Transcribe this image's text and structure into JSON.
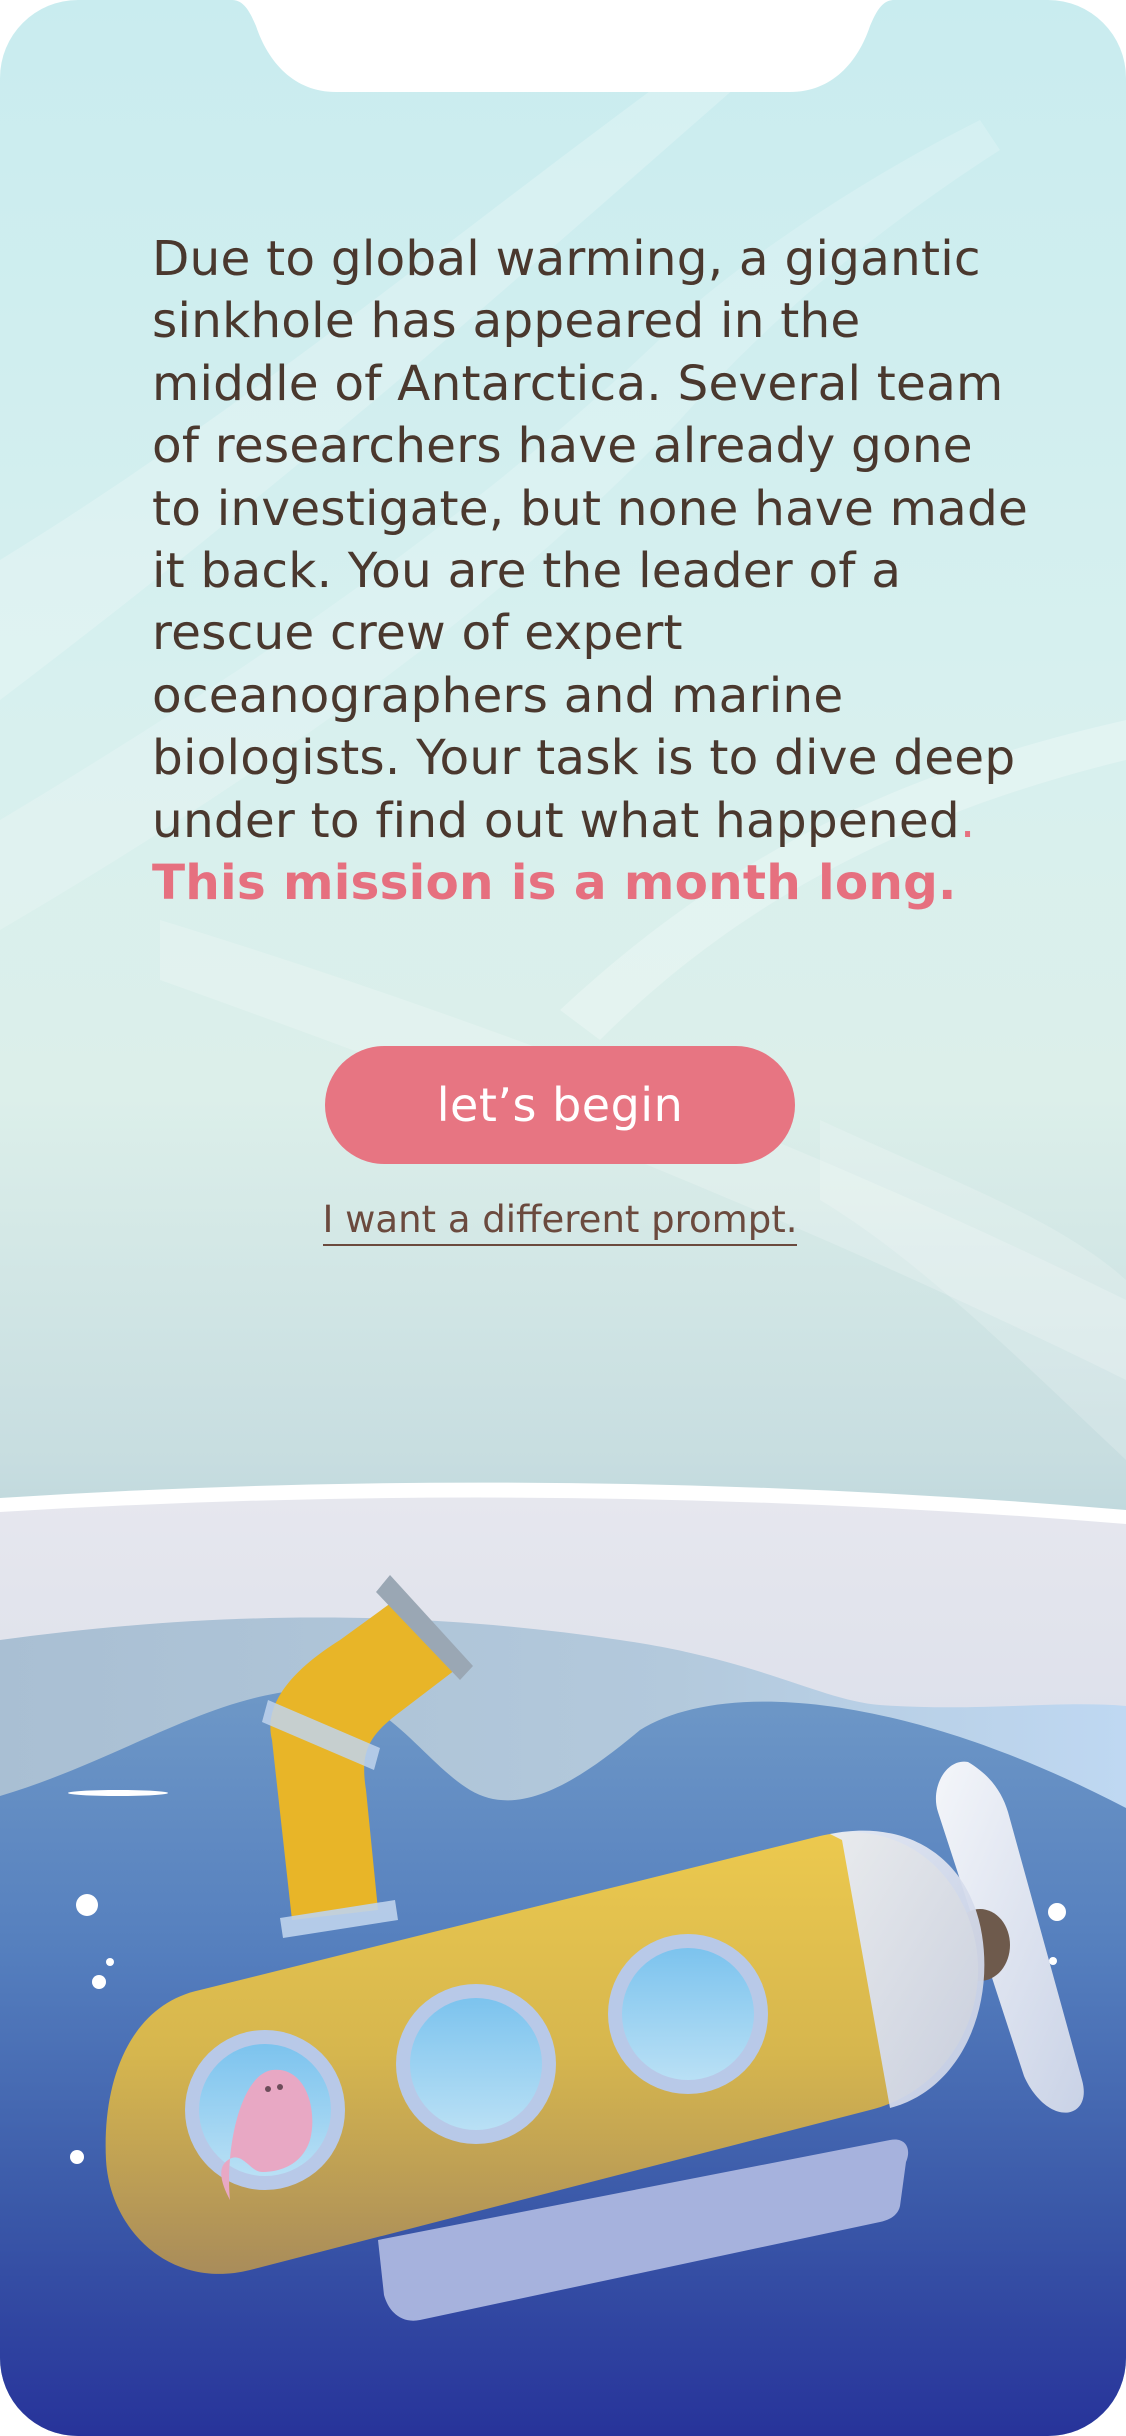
{
  "intro": {
    "story_text": "Due to global warming, a gigantic sinkhole has appeared in the middle of Antarctica. Several team of researchers have already gone to investigate, but none have made it back. You are the leader of a rescue crew of expert oceanographers and marine biologists. Your task is to dive deep under to find out what happened",
    "story_period": ".",
    "highlight_text": "This mission is a month long."
  },
  "actions": {
    "begin_label": "let’s begin",
    "different_prompt_label": "I want a different prompt."
  },
  "colors": {
    "accent": "#e77582",
    "text": "#4a382e",
    "link": "#6b4a3e",
    "submarine": "#e8c24a",
    "deep_water": "#2b3f9a"
  },
  "illustration": {
    "icon": "submarine-icon",
    "passenger": "pink-octopus-icon"
  }
}
